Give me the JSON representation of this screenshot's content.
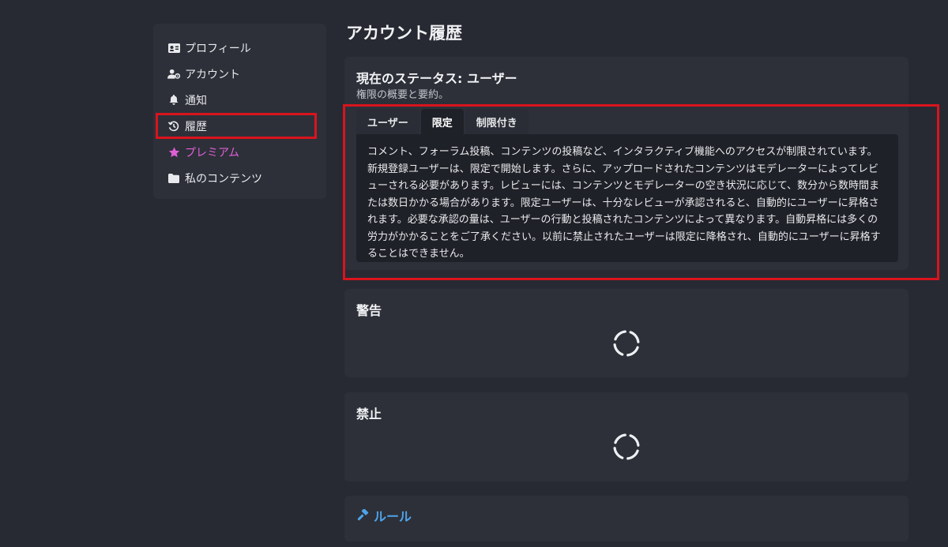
{
  "sidebar": {
    "items": [
      {
        "label": "プロフィール",
        "icon": "id-card-icon"
      },
      {
        "label": "アカウント",
        "icon": "user-gear-icon"
      },
      {
        "label": "通知",
        "icon": "bell-icon"
      },
      {
        "label": "履歴",
        "icon": "history-icon"
      },
      {
        "label": "プレミアム",
        "icon": "star-icon"
      },
      {
        "label": "私のコンテンツ",
        "icon": "folder-icon"
      }
    ]
  },
  "page": {
    "title": "アカウント履歴"
  },
  "status": {
    "title": "現在のステータス: ユーザー",
    "subtitle": "権限の概要と要約。",
    "tabs": [
      "ユーザー",
      "限定",
      "制限付き"
    ],
    "active_tab": "限定",
    "panel_text": "コメント、フォーラム投稿、コンテンツの投稿など、インタラクティブ機能へのアクセスが制限されています。新規登録ユーザーは、限定で開始します。さらに、アップロードされたコンテンツはモデレーターによってレビューされる必要があります。レビューには、コンテンツとモデレーターの空き状況に応じて、数分から数時間または数日かかる場合があります。限定ユーザーは、十分なレビューが承認されると、自動的にユーザーに昇格されます。必要な承認の量は、ユーザーの行動と投稿されたコンテンツによって異なります。自動昇格には多くの労力がかかることをご了承ください。以前に禁止されたユーザーは限定に降格され、自動的にユーザーに昇格することはできません。"
  },
  "warnings": {
    "title": "警告"
  },
  "bans": {
    "title": "禁止"
  },
  "rules": {
    "label": "ルール",
    "icon": "gavel-icon"
  },
  "colors": {
    "background": "#272a33",
    "card": "#2d3039",
    "panel": "#1f2128",
    "premium": "#e05fd6",
    "link": "#4ea3e9",
    "highlight": "#d9141d"
  }
}
